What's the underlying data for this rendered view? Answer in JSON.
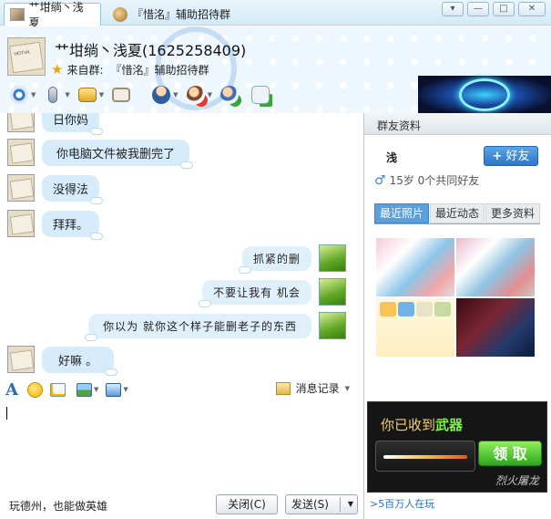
{
  "tabs": [
    {
      "label": "艹坩绱丶浅夏"
    },
    {
      "label": "『惜洺』辅助招待群"
    }
  ],
  "window_buttons": {
    "dropdown": "▾",
    "minimize": "—",
    "maximize": "□",
    "close": "✕"
  },
  "header": {
    "name": "艹坩绱丶浅夏(1625258409)",
    "from_label": "来自群:",
    "from_group": "『惜洺』辅助招待群"
  },
  "toolbar_icons": [
    "video-icon",
    "voice-icon",
    "file-transfer-icon",
    "screen-icon",
    "police-icon",
    "block-user-icon",
    "add-friend-icon",
    "sms-icon"
  ],
  "messages": [
    {
      "side": "in",
      "text": "日你妈"
    },
    {
      "side": "in",
      "text": "你电脑文件被我删完了"
    },
    {
      "side": "in",
      "text": "没得法"
    },
    {
      "side": "in",
      "text": "拜拜。"
    },
    {
      "side": "out",
      "text": "抓紧的删"
    },
    {
      "side": "out",
      "text": "不要让我有 机会"
    },
    {
      "side": "out",
      "text": "你以为 就你这个样子能删老子的东西"
    },
    {
      "side": "in",
      "text": "好嘛 。"
    }
  ],
  "format_bar": {
    "font_glyph": "A",
    "history_label": "消息记录"
  },
  "bottom": {
    "slogan": "玩德州，也能做英雄",
    "close_label": "关闭(C)",
    "send_label": "发送(S)"
  },
  "right_panel": {
    "title": "群友资料",
    "member_name": "浅",
    "add_button": "好友",
    "add_glyph": "+",
    "info": "15岁 0个共同好友",
    "tabs": [
      "最近照片",
      "最近动态",
      "更多资料"
    ],
    "ad": {
      "line1": "你已收到",
      "line1_highlight": "武器",
      "claim": "领 取",
      "brand": "烈火屠龙"
    },
    "footer": ">5百万人在玩"
  }
}
